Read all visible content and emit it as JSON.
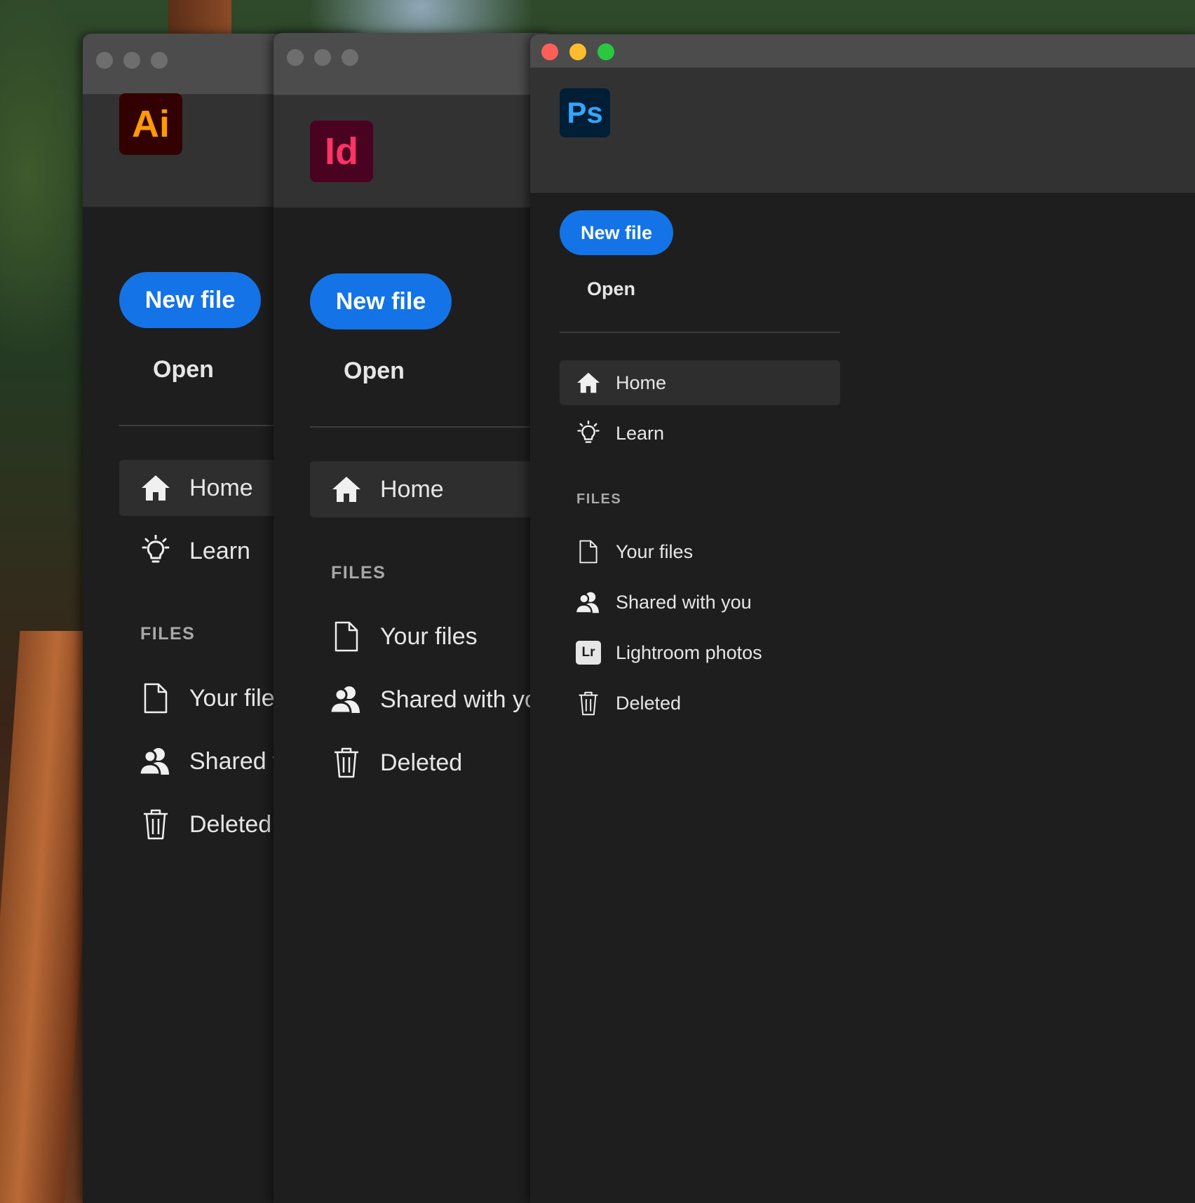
{
  "windows": {
    "illustrator": {
      "logo": "Ai",
      "logo_colors": {
        "bg": "#330000",
        "fg": "#ff9a00"
      },
      "new_file": "New file",
      "open": "Open",
      "nav": {
        "home": "Home",
        "learn": "Learn"
      },
      "files_label": "FILES",
      "files": {
        "your_files": "Your files",
        "shared": "Shared with you",
        "deleted": "Deleted"
      }
    },
    "indesign": {
      "logo": "Id",
      "logo_colors": {
        "bg": "#49021f",
        "fg": "#ff3366"
      },
      "new_file": "New file",
      "open": "Open",
      "nav": {
        "home": "Home"
      },
      "files_label": "FILES",
      "files": {
        "your_files": "Your files",
        "shared": "Shared with you",
        "deleted": "Deleted"
      }
    },
    "photoshop": {
      "logo": "Ps",
      "logo_colors": {
        "bg": "#001e36",
        "fg": "#31a8ff"
      },
      "new_file": "New file",
      "open": "Open",
      "nav": {
        "home": "Home",
        "learn": "Learn"
      },
      "files_label": "FILES",
      "files": {
        "your_files": "Your files",
        "shared": "Shared with you",
        "lightroom": "Lightroom photos",
        "deleted": "Deleted"
      },
      "lightroom_badge": "Lr"
    }
  },
  "colors": {
    "accent": "#1473e6",
    "close": "#ff5f57",
    "minimize": "#febc2e",
    "zoom": "#28c840",
    "inactive_dot": "#6e6e6e"
  }
}
